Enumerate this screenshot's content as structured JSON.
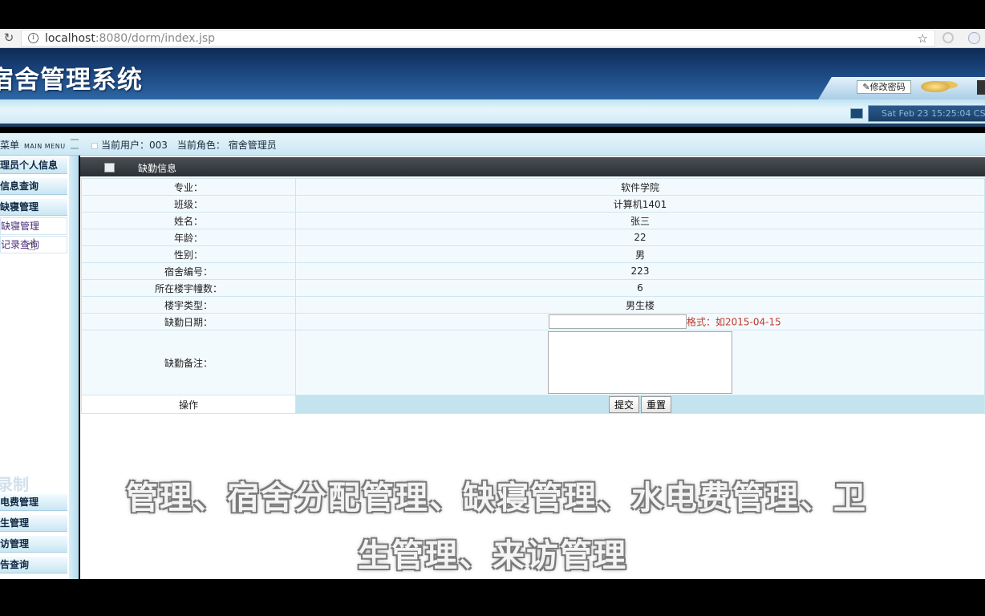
{
  "browser": {
    "url_host": "localhost",
    "url_rest": ":8080/dorm/index.jsp"
  },
  "header": {
    "app_title": "宿舍管理系统",
    "change_password": "修改密码",
    "datetime": "Sat Feb 23 15:25:04 CS"
  },
  "crumb": {
    "menu_label": "菜单",
    "menu_label_en": "MAIN MENU",
    "user_info": "当前用户：003　当前角色： 宿舍管理员"
  },
  "sidebar": {
    "items": [
      {
        "label": "理员个人信息"
      },
      {
        "label": "信息查询"
      },
      {
        "label": "缺寝管理"
      },
      {
        "label": "缺寝管理"
      },
      {
        "label": "记录查询"
      }
    ],
    "lower": [
      {
        "label": "电费管理"
      },
      {
        "label": "生管理"
      },
      {
        "label": "访管理"
      },
      {
        "label": "告查询"
      }
    ]
  },
  "panel": {
    "title": "缺勤信息"
  },
  "form": {
    "rows": [
      {
        "label": "专业：",
        "value": "软件学院"
      },
      {
        "label": "班级：",
        "value": "计算机1401"
      },
      {
        "label": "姓名：",
        "value": "张三"
      },
      {
        "label": "年龄：",
        "value": "22"
      },
      {
        "label": "性别：",
        "value": "男"
      },
      {
        "label": "宿舍编号：",
        "value": "223"
      },
      {
        "label": "所在楼宇幢数：",
        "value": "6"
      },
      {
        "label": "楼宇类型：",
        "value": "男生楼"
      }
    ],
    "date_label": "缺勤日期：",
    "date_value": "",
    "date_hint": "格式：如2015-04-15",
    "remark_label": "缺勤备注：",
    "remark_value": "",
    "op_label": "操作",
    "submit": "提交",
    "reset": "重置"
  },
  "overlay": {
    "watermark": "录制",
    "subtitle_line1": "管理、宿舍分配管理、缺寝管理、水电费管理、卫",
    "subtitle_line2": "生管理、来访管理"
  }
}
